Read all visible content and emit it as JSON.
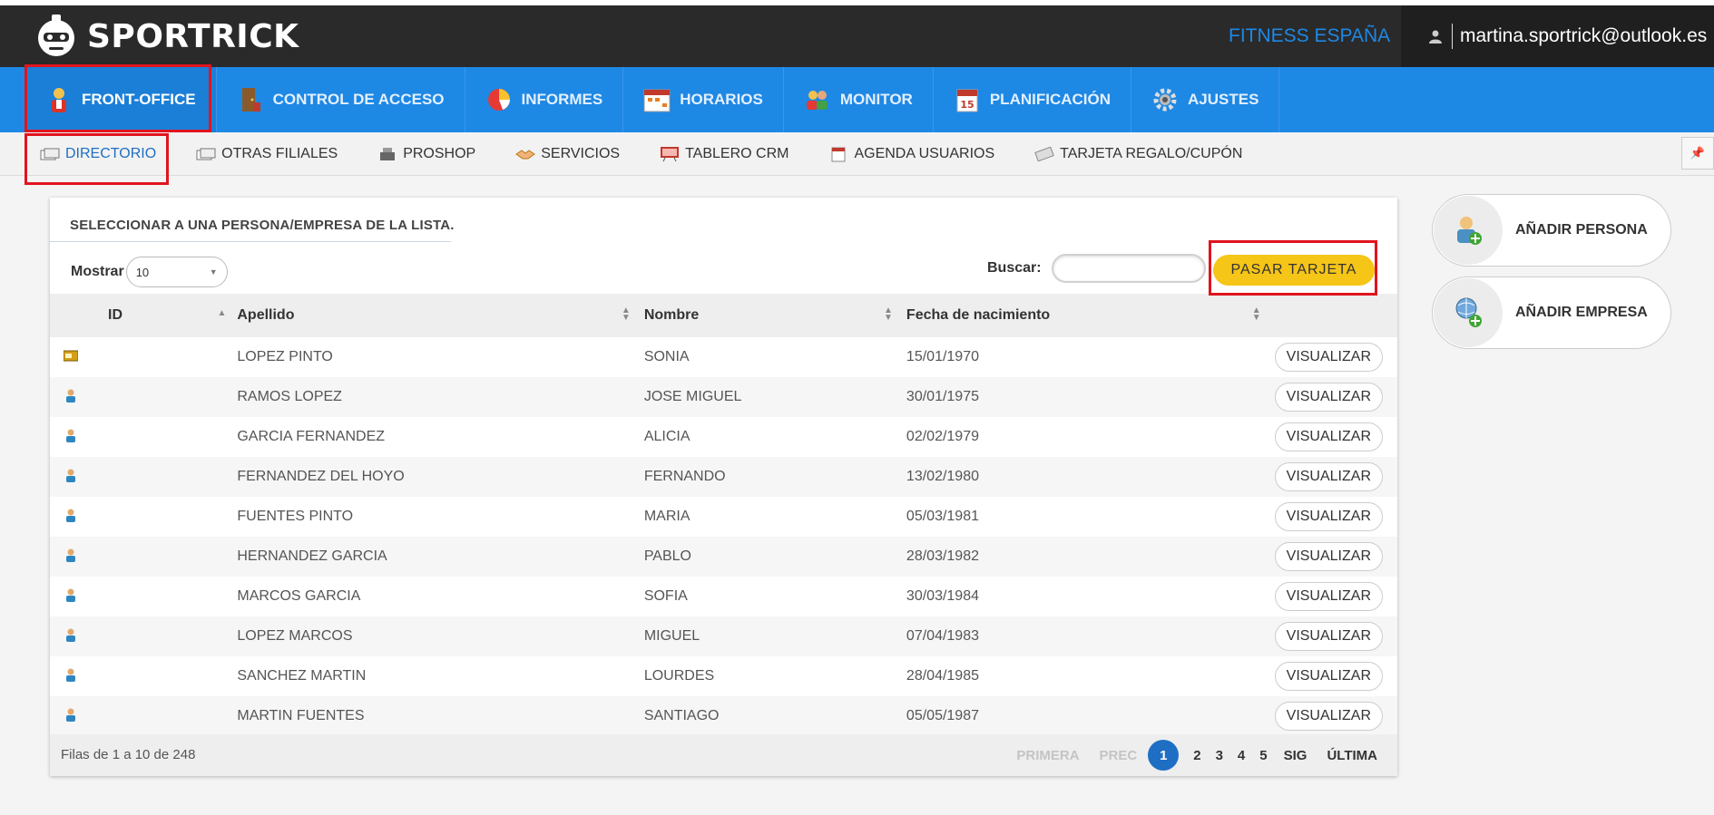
{
  "brand": {
    "name": "SPORTRICK"
  },
  "header": {
    "company": "FITNESS ESPAÑA",
    "user_email": "martina.sportrick@outlook.es"
  },
  "main_nav": [
    {
      "label": "FRONT-OFFICE",
      "icon": "receptionist-icon",
      "active": true
    },
    {
      "label": "CONTROL DE ACCESO",
      "icon": "door-access-icon",
      "active": false
    },
    {
      "label": "INFORMES",
      "icon": "pie-chart-icon",
      "active": false
    },
    {
      "label": "HORARIOS",
      "icon": "calendar-grid-icon",
      "active": false
    },
    {
      "label": "MONITOR",
      "icon": "people-icon",
      "active": false
    },
    {
      "label": "PLANIFICACIÓN",
      "icon": "calendar-15-icon",
      "active": false
    },
    {
      "label": "AJUSTES",
      "icon": "gear-icon",
      "active": false
    }
  ],
  "sub_nav": [
    {
      "label": "DIRECTORIO",
      "icon": "cards-icon",
      "active": true
    },
    {
      "label": "OTRAS FILIALES",
      "icon": "cards-icon",
      "active": false
    },
    {
      "label": "PROSHOP",
      "icon": "cash-register-icon",
      "active": false
    },
    {
      "label": "SERVICIOS",
      "icon": "handshake-icon",
      "active": false
    },
    {
      "label": "TABLERO CRM",
      "icon": "board-icon",
      "active": false
    },
    {
      "label": "AGENDA USUARIOS",
      "icon": "agenda-icon",
      "active": false
    },
    {
      "label": "TARJETA REGALO/CUPÓN",
      "icon": "gift-card-icon",
      "active": false
    }
  ],
  "panel": {
    "title": "SELECCIONAR A UNA PERSONA/EMPRESA DE LA LISTA.",
    "show_label": "Mostrar",
    "show_value": "10",
    "search_label": "Buscar:",
    "search_value": "",
    "swipe_button": "PASAR TARJETA"
  },
  "table": {
    "columns": [
      "ID",
      "Apellido",
      "Nombre",
      "Fecha de nacimiento"
    ],
    "action_label": "VISUALIZAR",
    "rows": [
      {
        "type": "card",
        "apellido": "LOPEZ PINTO",
        "nombre": "SONIA",
        "fecha": "15/01/1970"
      },
      {
        "type": "person",
        "apellido": "RAMOS LOPEZ",
        "nombre": "JOSE MIGUEL",
        "fecha": "30/01/1975"
      },
      {
        "type": "person",
        "apellido": "GARCIA FERNANDEZ",
        "nombre": "ALICIA",
        "fecha": "02/02/1979"
      },
      {
        "type": "person",
        "apellido": "FERNANDEZ DEL HOYO",
        "nombre": "FERNANDO",
        "fecha": "13/02/1980"
      },
      {
        "type": "person",
        "apellido": "FUENTES PINTO",
        "nombre": "MARIA",
        "fecha": "05/03/1981"
      },
      {
        "type": "person",
        "apellido": "HERNANDEZ GARCIA",
        "nombre": "PABLO",
        "fecha": "28/03/1982"
      },
      {
        "type": "person",
        "apellido": "MARCOS GARCIA",
        "nombre": "SOFIA",
        "fecha": "30/03/1984"
      },
      {
        "type": "person",
        "apellido": "LOPEZ MARCOS",
        "nombre": "MIGUEL",
        "fecha": "07/04/1983"
      },
      {
        "type": "person",
        "apellido": "SANCHEZ MARTIN",
        "nombre": "LOURDES",
        "fecha": "28/04/1985"
      },
      {
        "type": "person",
        "apellido": "MARTIN FUENTES",
        "nombre": "SANTIAGO",
        "fecha": "05/05/1987"
      }
    ]
  },
  "footer": {
    "info": "Filas de 1 a 10 de 248",
    "first": "PRIMERA",
    "prev": "PREC",
    "pages": [
      "1",
      "2",
      "3",
      "4",
      "5"
    ],
    "current_page": "1",
    "next": "SIG",
    "last": "ÚLTIMA"
  },
  "side_actions": {
    "add_person": "AÑADIR PERSONA",
    "add_company": "AÑADIR EMPRESA"
  },
  "colors": {
    "topbar": "#2a2a2a",
    "nav_blue": "#1e88e5",
    "accent_yellow": "#f5c518",
    "highlight_red": "#e0141e"
  }
}
